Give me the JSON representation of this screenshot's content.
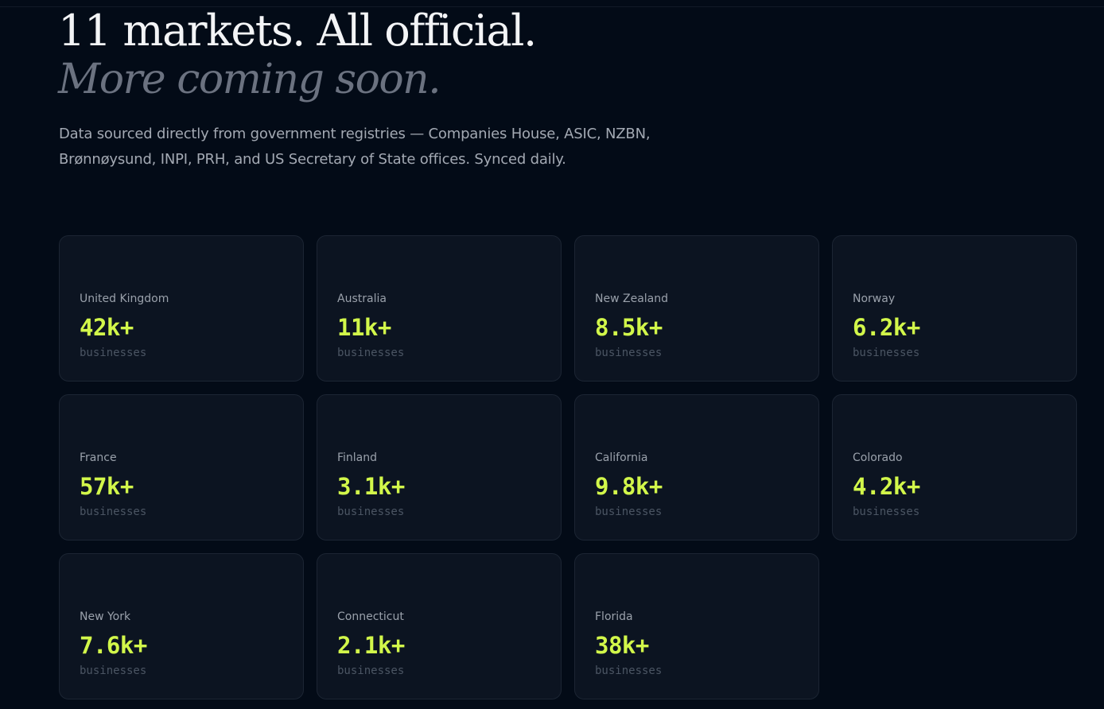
{
  "header": {
    "title_line1": "11 markets. All official.",
    "title_line2": "More coming soon.",
    "subtitle": "Data sourced directly from government registries — Companies House, ASIC, NZBN, Brønnøysund, INPI, PRH, and US Secretary of State offices. Synced daily."
  },
  "markets": [
    {
      "name": "United Kingdom",
      "count": "42k+",
      "unit": "businesses"
    },
    {
      "name": "Australia",
      "count": "11k+",
      "unit": "businesses"
    },
    {
      "name": "New Zealand",
      "count": "8.5k+",
      "unit": "businesses"
    },
    {
      "name": "Norway",
      "count": "6.2k+",
      "unit": "businesses"
    },
    {
      "name": "France",
      "count": "57k+",
      "unit": "businesses"
    },
    {
      "name": "Finland",
      "count": "3.1k+",
      "unit": "businesses"
    },
    {
      "name": "California",
      "count": "9.8k+",
      "unit": "businesses"
    },
    {
      "name": "Colorado",
      "count": "4.2k+",
      "unit": "businesses"
    },
    {
      "name": "New York",
      "count": "7.6k+",
      "unit": "businesses"
    },
    {
      "name": "Connecticut",
      "count": "2.1k+",
      "unit": "businesses"
    },
    {
      "name": "Florida",
      "count": "38k+",
      "unit": "businesses"
    }
  ],
  "colors": {
    "background": "#030b17",
    "card": "#0c1421",
    "accent": "#d2f74a",
    "muted": "#6b7280"
  }
}
